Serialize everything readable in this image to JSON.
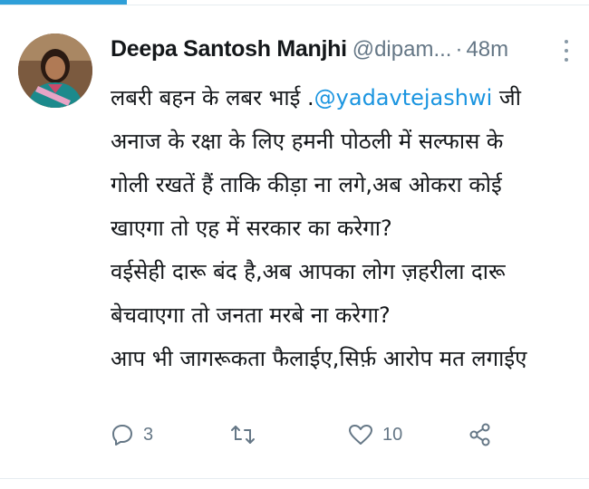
{
  "tweet": {
    "author_name": "Deepa Santosh Manjhi",
    "author_handle": "@dipam...",
    "separator": "·",
    "time": "48m",
    "text_lines": [
      {
        "before": "लबरी बहन के लबर भाई .",
        "mention": "@yadavtejashwi",
        "after": " जी"
      },
      {
        "text": "अनाज के रक्षा के लिए हमनी पोठली में सल्फास के"
      },
      {
        "text": "गोली रखतें हैं ताकि कीड़ा ना लगे,अब ओकरा कोई"
      },
      {
        "text": "खाएगा तो एह में सरकार का करेगा?"
      },
      {
        "text": "वईसेही दारू बंद है,अब आपका लोग ज़हरीला दारू"
      },
      {
        "text": "बेचवाएगा तो जनता मरबे ना करेगा?"
      },
      {
        "text": "आप भी जागरूकता फैलाईए,सिर्फ़ आरोप मत लगाईए"
      }
    ],
    "reply_count": "3",
    "retweet_count": "",
    "like_count": "10"
  },
  "colors": {
    "accent": "#1b95e0",
    "tab_indicator": "#2f9fd8",
    "text": "#14171a",
    "muted": "#657786"
  },
  "icons": {
    "reply": "reply-icon",
    "retweet": "retweet-icon",
    "like": "heart-icon",
    "share": "share-icon",
    "more": "more-vertical-icon"
  }
}
